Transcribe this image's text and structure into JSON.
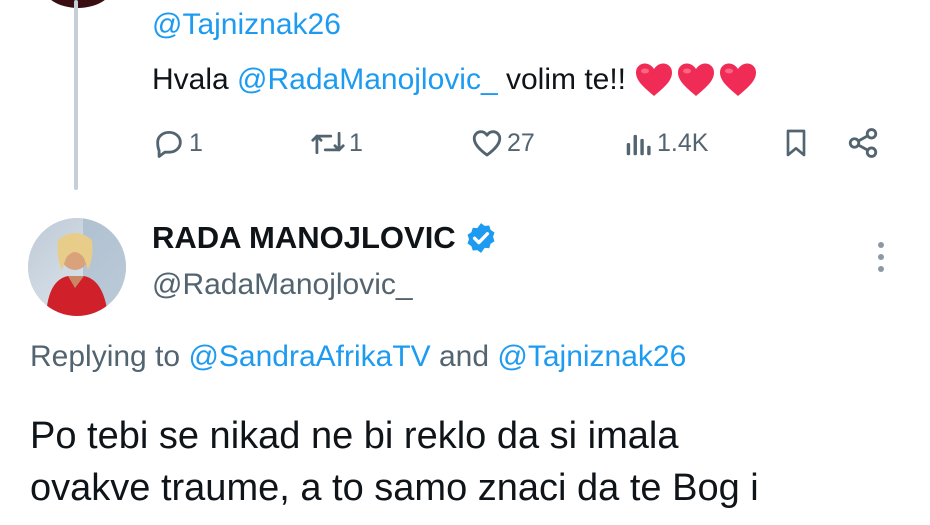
{
  "prev_tweet": {
    "handle": "@Tajniznak26",
    "text_prefix": "Hvala ",
    "mention": "@RadaManojlovic_",
    "text_suffix": " volim te!!",
    "emoji": "heart-emoji x3",
    "actions": {
      "replies": "1",
      "retweets": "1",
      "likes": "27",
      "views": "1.4K"
    }
  },
  "tweet": {
    "name": "RADA MANOJLOVIC",
    "verified": true,
    "handle": "@RadaManojlovic_",
    "replying_prefix": "Replying to ",
    "replying_to_1": "@SandraAfrikaTV",
    "replying_and": " and ",
    "replying_to_2": "@Tajniznak26",
    "text": "Po tebi se nikad ne bi reklo da si imala\novakve traume, a to samo znaci da te Bog i"
  },
  "colors": {
    "accent": "#1d9bf0",
    "muted": "#536471",
    "heart": "#f02c56",
    "text": "#0f1419"
  }
}
